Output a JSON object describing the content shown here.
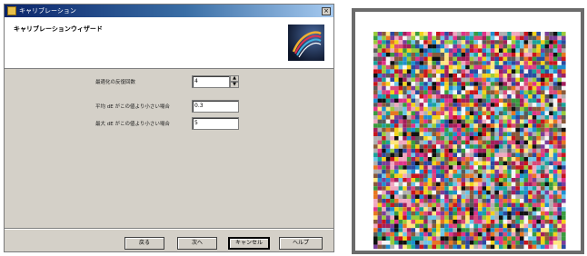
{
  "dialog": {
    "window_title": "キャリブレーション",
    "close_label": "×",
    "header_title": "キャリブレーションウィザード",
    "fields": [
      {
        "label": "最適化の反復回数",
        "value": "4"
      },
      {
        "label": "平均 dE がこの値より小さい場合",
        "value": "0.3"
      },
      {
        "label": "最大 dE がこの値より小さい場合",
        "value": "5"
      }
    ],
    "buttons": {
      "back": "戻る",
      "next": "次へ",
      "cancel": "キャンセル",
      "help": "ヘルプ"
    },
    "icons": {
      "spin_up": "▲",
      "spin_down": "▼"
    }
  },
  "target_chart": {
    "palette": [
      "#c8161d",
      "#e0338a",
      "#1f8fd0",
      "#f2d21b",
      "#3a9b3f",
      "#7b3d9a",
      "#111111",
      "#f5f5f5",
      "#e87722",
      "#6bc6e8",
      "#8a5a3a",
      "#9bcb3c",
      "#d94a7a",
      "#2b4aa0",
      "#b0b0b0",
      "#5a5a5a",
      "#f0a8c0",
      "#1aa39a",
      "#a31f5c",
      "#ffe680"
    ]
  }
}
